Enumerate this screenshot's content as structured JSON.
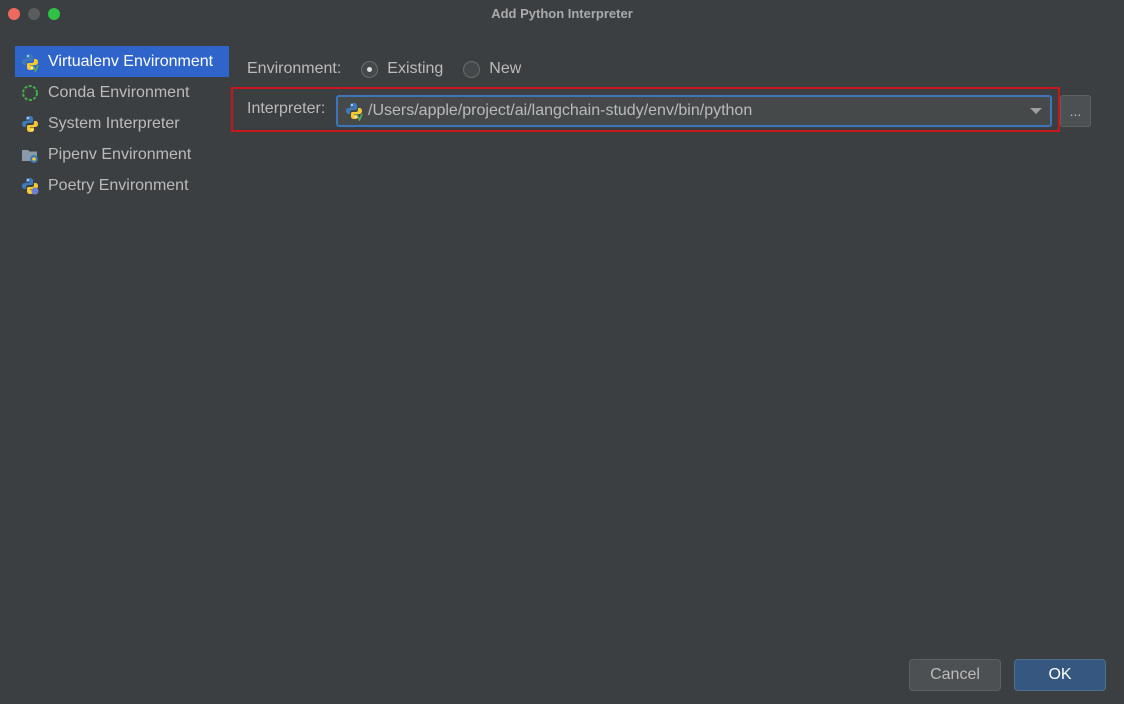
{
  "window": {
    "title": "Add Python Interpreter"
  },
  "sidebar": {
    "items": [
      {
        "label": "Virtualenv Environment",
        "icon": "python-virtualenv-icon",
        "selected": true
      },
      {
        "label": "Conda Environment",
        "icon": "conda-icon",
        "selected": false
      },
      {
        "label": "System Interpreter",
        "icon": "python-icon",
        "selected": false
      },
      {
        "label": "Pipenv Environment",
        "icon": "pipenv-icon",
        "selected": false
      },
      {
        "label": "Poetry Environment",
        "icon": "poetry-icon",
        "selected": false
      }
    ]
  },
  "environment": {
    "label": "Environment:",
    "options": [
      {
        "label": "Existing",
        "checked": true
      },
      {
        "label": "New",
        "checked": false
      }
    ]
  },
  "interpreter": {
    "label": "Interpreter:",
    "value": "/Users/apple/project/ai/langchain-study/env/bin/python",
    "browse_label": "..."
  },
  "footer": {
    "cancel_label": "Cancel",
    "ok_label": "OK"
  },
  "colors": {
    "background": "#3c3f41",
    "selection": "#2f65ca",
    "highlight_border": "#c8161d",
    "focus_border": "#3d76b8",
    "ok_button": "#365880"
  }
}
